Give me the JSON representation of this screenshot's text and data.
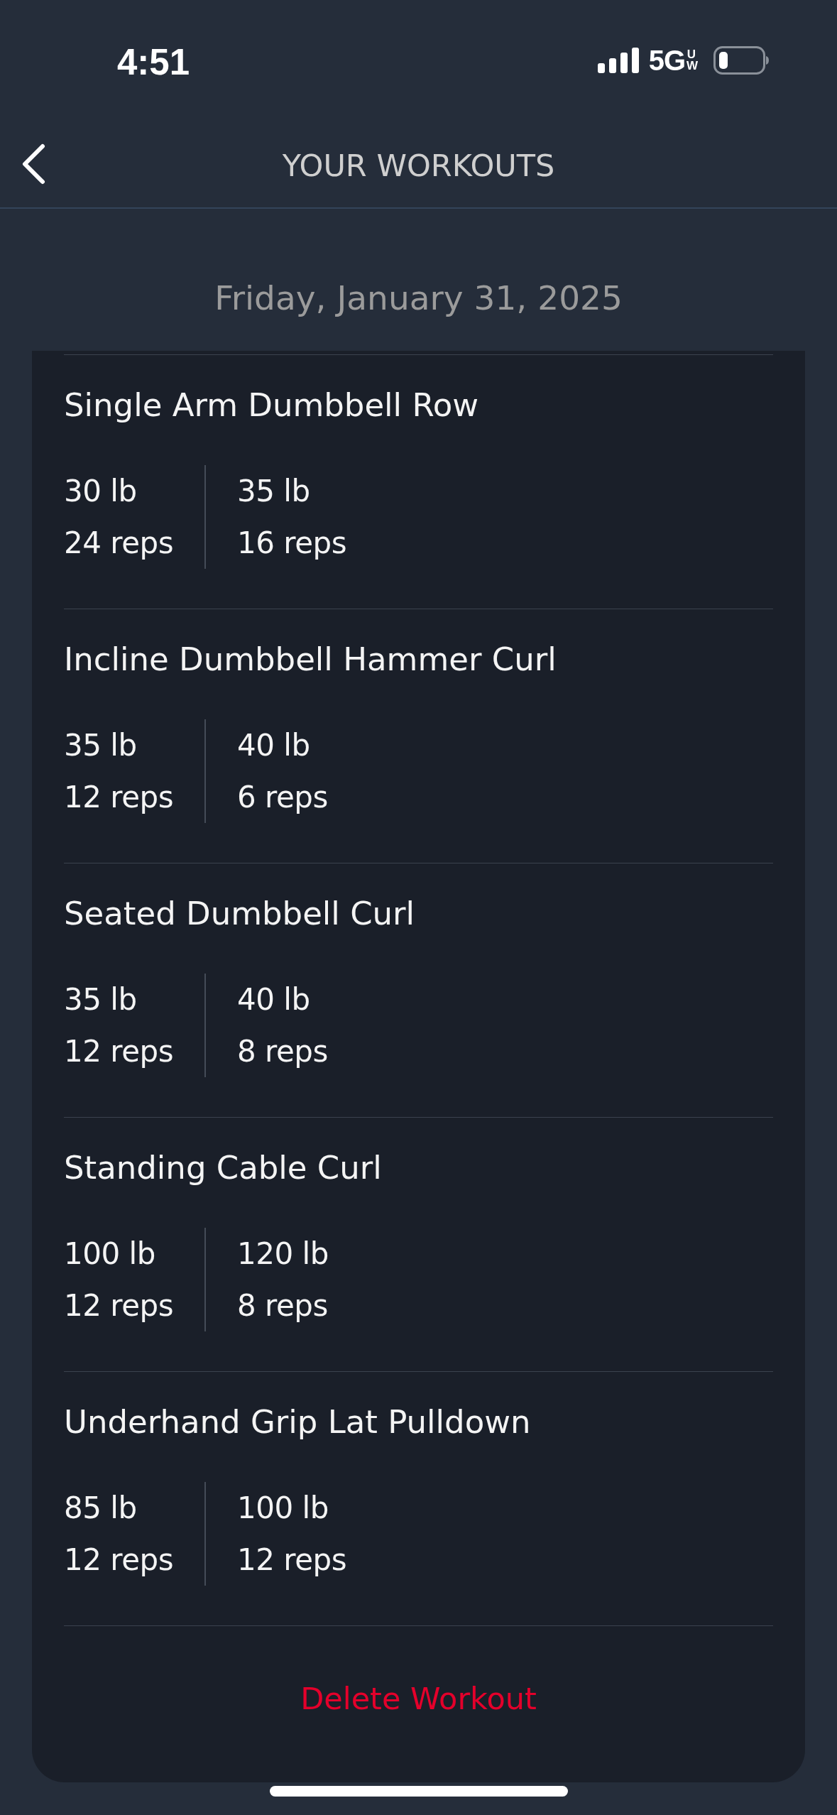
{
  "status_bar": {
    "time": "4:51",
    "network": "5G",
    "network_badge": "UW"
  },
  "nav": {
    "title": "YOUR WORKOUTS"
  },
  "date": "Friday, January 31, 2025",
  "exercises": [
    {
      "name": "Single Arm Dumbbell Row",
      "sets": [
        {
          "weight": "30 lb",
          "reps": "24 reps"
        },
        {
          "weight": "35 lb",
          "reps": "16 reps"
        }
      ]
    },
    {
      "name": "Incline Dumbbell Hammer Curl",
      "sets": [
        {
          "weight": "35 lb",
          "reps": "12 reps"
        },
        {
          "weight": "40 lb",
          "reps": "6 reps"
        }
      ]
    },
    {
      "name": "Seated Dumbbell Curl",
      "sets": [
        {
          "weight": "35 lb",
          "reps": "12 reps"
        },
        {
          "weight": "40 lb",
          "reps": "8 reps"
        }
      ]
    },
    {
      "name": "Standing Cable Curl",
      "sets": [
        {
          "weight": "100 lb",
          "reps": "12 reps"
        },
        {
          "weight": "120 lb",
          "reps": "8 reps"
        }
      ]
    },
    {
      "name": "Underhand Grip Lat Pulldown",
      "sets": [
        {
          "weight": "85 lb",
          "reps": "12 reps"
        },
        {
          "weight": "100 lb",
          "reps": "12 reps"
        }
      ]
    }
  ],
  "delete_button": "Delete Workout"
}
